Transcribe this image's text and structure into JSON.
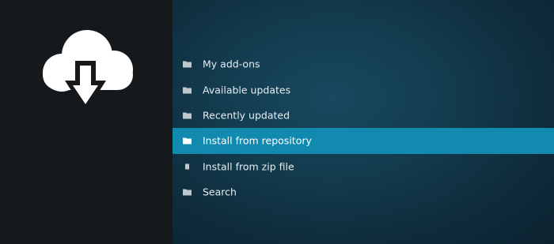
{
  "colors": {
    "left_panel": "#15191b",
    "right_panel": "#133b4e",
    "selected_bg": "#128ab0",
    "text": "#e6eef2",
    "icon": "#bfc8cc"
  },
  "sidebar": {
    "icon": "cloud-download-icon"
  },
  "menu": {
    "items": [
      {
        "label": "My add-ons",
        "icon": "folder-icon",
        "selected": false
      },
      {
        "label": "Available updates",
        "icon": "folder-icon",
        "selected": false
      },
      {
        "label": "Recently updated",
        "icon": "folder-icon",
        "selected": false
      },
      {
        "label": "Install from repository",
        "icon": "folder-icon",
        "selected": true
      },
      {
        "label": "Install from zip file",
        "icon": "zip-file-icon",
        "selected": false
      },
      {
        "label": "Search",
        "icon": "folder-icon",
        "selected": false
      }
    ]
  }
}
